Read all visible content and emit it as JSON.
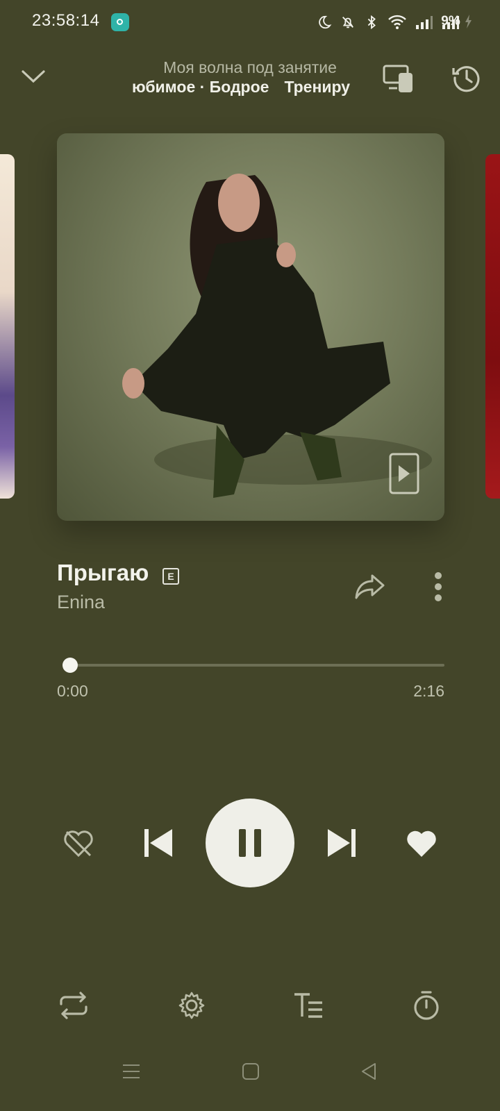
{
  "status_bar": {
    "time": "23:58:14",
    "battery": "9%",
    "icons": [
      "moon-icon",
      "bell-off-icon",
      "bluetooth-icon",
      "wifi-icon",
      "signal-icon",
      "signal-icon",
      "charging-icon"
    ]
  },
  "header": {
    "title": "Моя волна под занятие",
    "tags": [
      "юбимое · Бодрое",
      "Трениру"
    ]
  },
  "track": {
    "title": "Прыгаю",
    "explicit": "E",
    "artist": "Enina",
    "current_time": "0:00",
    "duration": "2:16",
    "progress": 0.0
  },
  "controls": {
    "items": [
      "dislike-icon",
      "previous-icon",
      "pause-icon",
      "next-icon",
      "like-icon"
    ]
  },
  "bottom_toolbar": {
    "items": [
      "repeat-icon",
      "settings-icon",
      "lyrics-icon",
      "timer-icon"
    ]
  },
  "colors": {
    "background": "#434529",
    "accent": "#efefe8"
  }
}
